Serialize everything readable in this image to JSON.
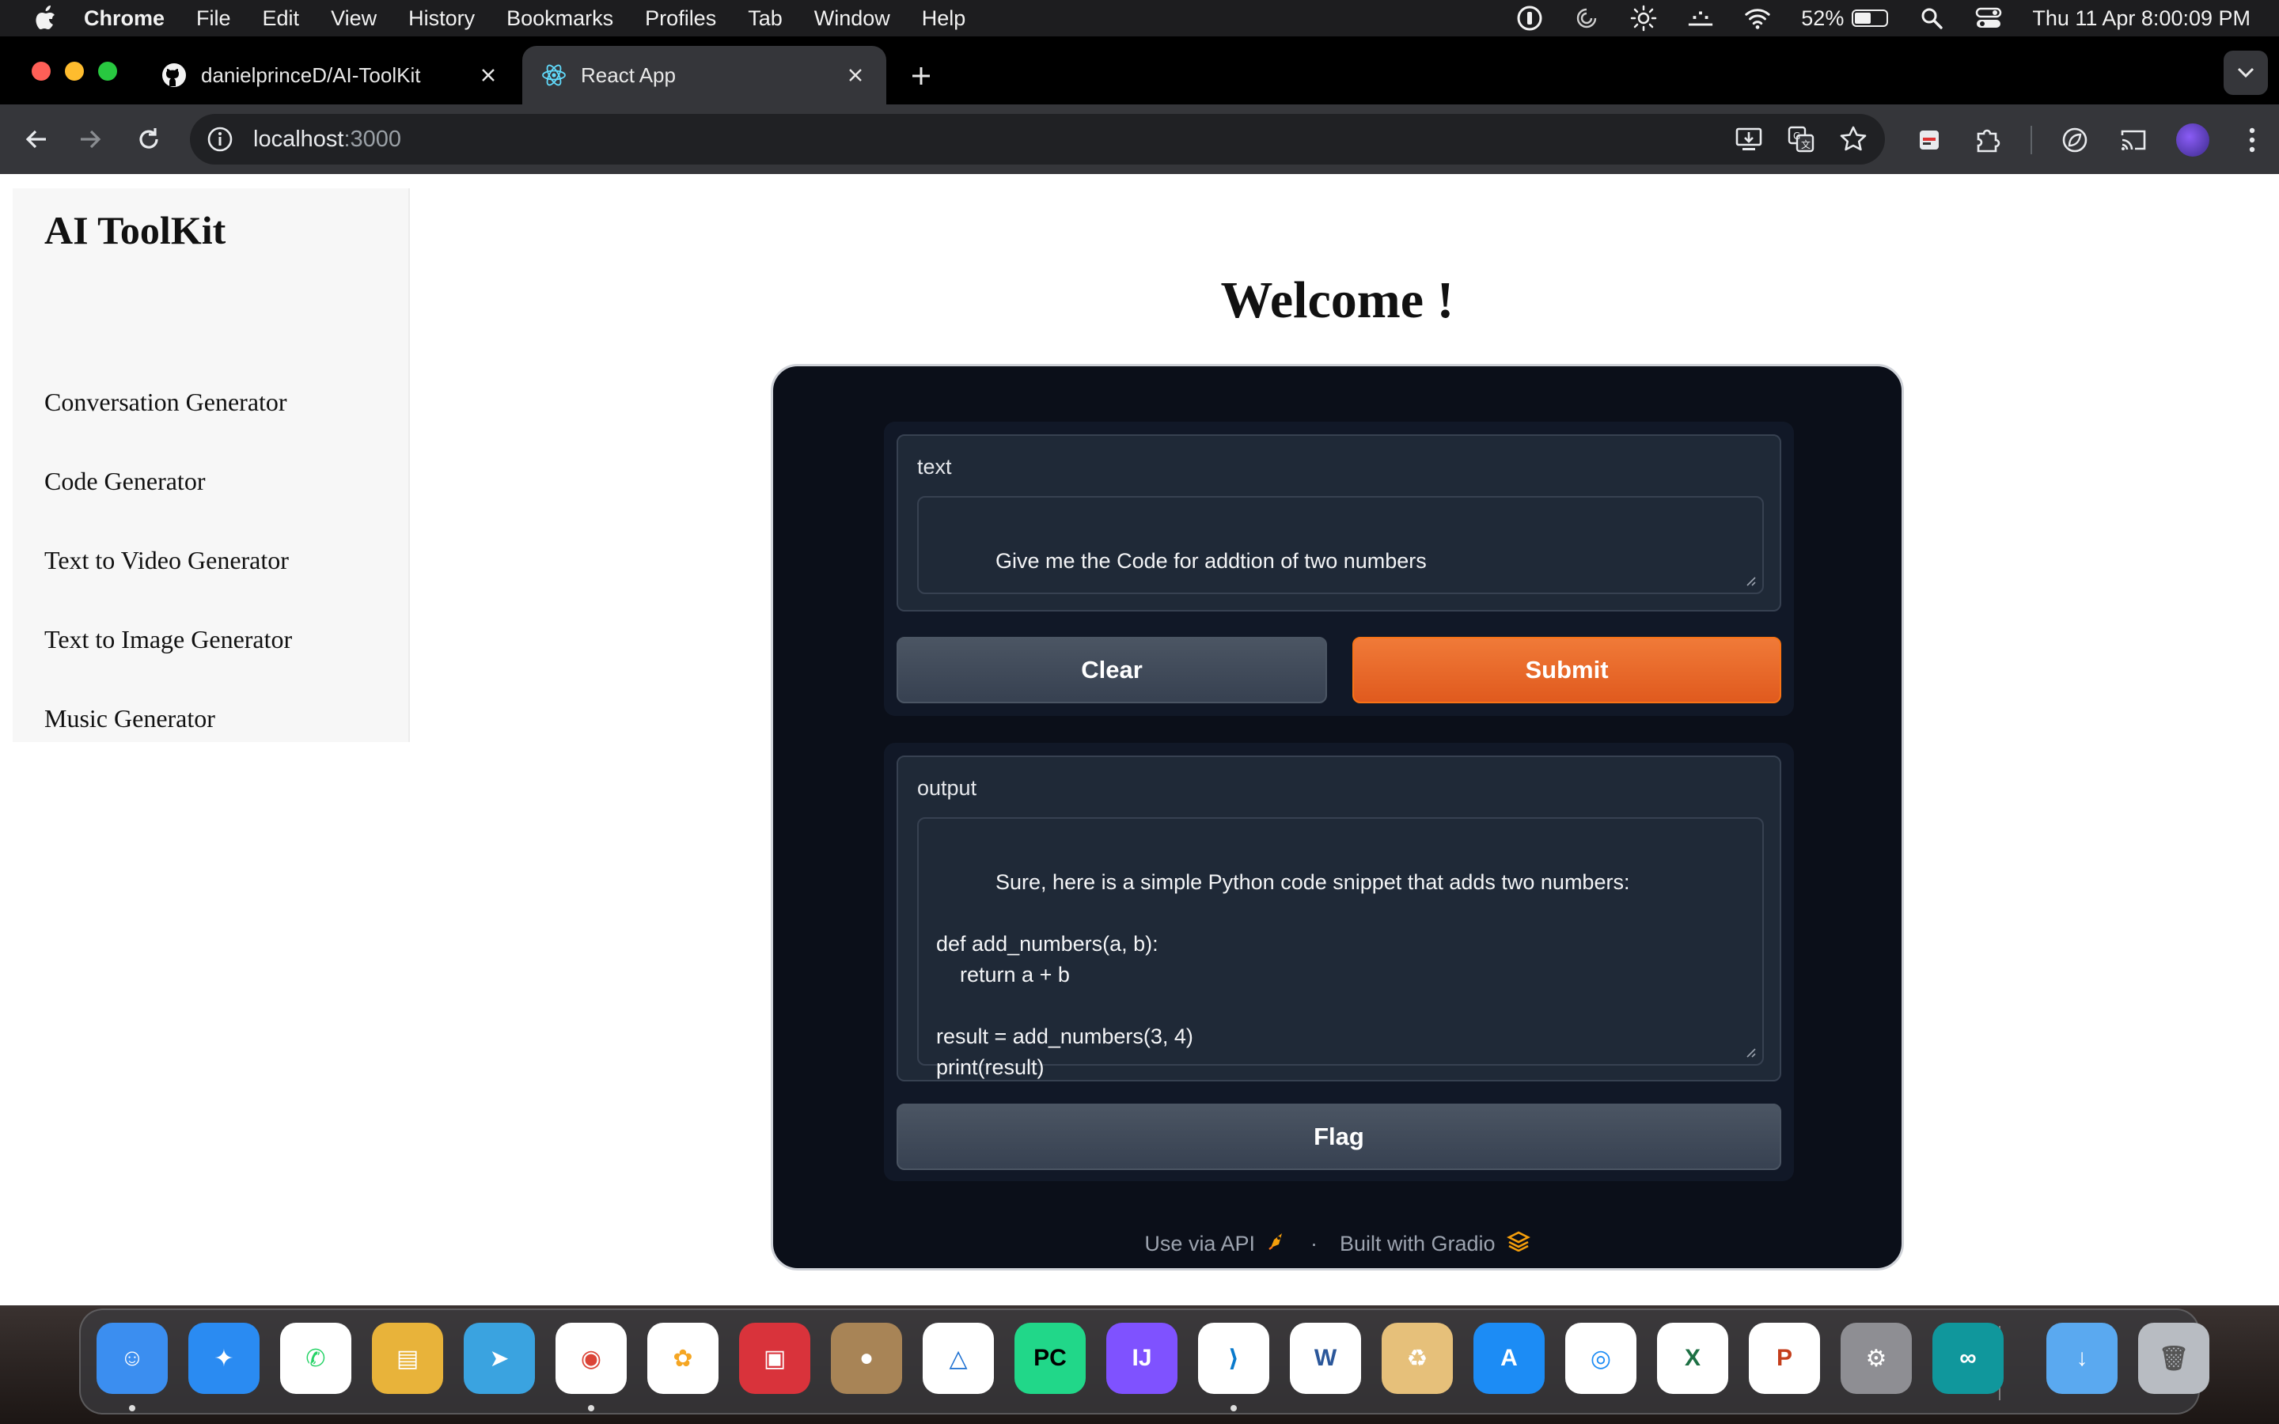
{
  "menubar": {
    "app_name": "Chrome",
    "items": [
      "File",
      "Edit",
      "View",
      "History",
      "Bookmarks",
      "Profiles",
      "Tab",
      "Window",
      "Help"
    ],
    "battery_percent": "52%",
    "battery_level": 0.52,
    "datetime": "Thu 11 Apr  8:00:09 PM"
  },
  "browser": {
    "tabs": [
      {
        "label": "danielprinceD/AI-ToolKit",
        "icon": "github-icon",
        "active": false
      },
      {
        "label": "React App",
        "icon": "react-icon",
        "active": true
      }
    ],
    "url_host": "localhost",
    "url_port": ":3000"
  },
  "sidebar": {
    "brand": "AI ToolKit",
    "items": [
      {
        "label": "Conversation Generator"
      },
      {
        "label": "Code Generator"
      },
      {
        "label": "Text to Video Generator"
      },
      {
        "label": "Text to Image Generator"
      },
      {
        "label": "Music Generator"
      }
    ]
  },
  "main": {
    "heading": "Welcome !"
  },
  "gradio": {
    "input_label": "text",
    "input_value": "Give me the Code for addtion of two numbers",
    "clear_label": "Clear",
    "submit_label": "Submit",
    "output_label": "output",
    "output_value": "Sure, here is a simple Python code snippet that adds two numbers:\n\ndef add_numbers(a, b):\n    return a + b\n\nresult = add_numbers(3, 4)\nprint(result)",
    "flag_label": "Flag",
    "footer_api": "Use via API",
    "footer_sep": "·",
    "footer_built": "Built with Gradio"
  },
  "dock": {
    "apps": [
      {
        "name": "finder-icon",
        "color": "#3b8ef0"
      },
      {
        "name": "safari-icon",
        "color": "#2a8bf2"
      },
      {
        "name": "whatsapp-icon",
        "color": "#ffffff"
      },
      {
        "name": "classroom-icon",
        "color": "#e8b33a"
      },
      {
        "name": "telegram-icon",
        "color": "#3aa3e0"
      },
      {
        "name": "chrome-icon",
        "color": "#ffffff"
      },
      {
        "name": "photos-icon",
        "color": "#ffffff"
      },
      {
        "name": "photo-booth-icon",
        "color": "#d9333b"
      },
      {
        "name": "contacts-icon",
        "color": "#a88456"
      },
      {
        "name": "instruments-icon",
        "color": "#ffffff"
      },
      {
        "name": "pycharm-icon",
        "color": "#21d789"
      },
      {
        "name": "intellij-icon",
        "color": "#7f52ff"
      },
      {
        "name": "vscode-icon",
        "color": "#ffffff"
      },
      {
        "name": "word-icon",
        "color": "#ffffff"
      },
      {
        "name": "archive-utility-icon",
        "color": "#e6c07a"
      },
      {
        "name": "app-store-icon",
        "color": "#1c8cf5"
      },
      {
        "name": "airdrop-icon",
        "color": "#ffffff"
      },
      {
        "name": "excel-icon",
        "color": "#ffffff"
      },
      {
        "name": "powerpoint-icon",
        "color": "#ffffff"
      },
      {
        "name": "system-settings-icon",
        "color": "#8e8e93"
      },
      {
        "name": "arduino-icon",
        "color": "#10979c"
      },
      {
        "name": "downloads-folder-icon",
        "color": "#5aa9f0"
      },
      {
        "name": "trash-icon",
        "color": "#b8bcc2"
      }
    ]
  }
}
